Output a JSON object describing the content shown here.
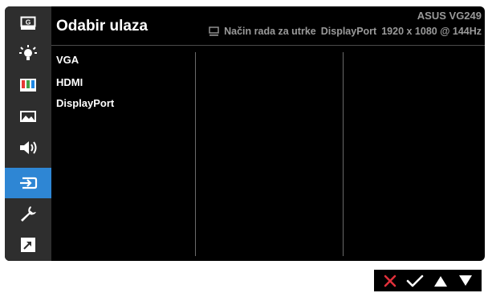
{
  "header": {
    "title": "Odabir ulaza",
    "model": "ASUS  VG249",
    "mode": "Način rada za utrke",
    "input": "DisplayPort",
    "resolution": "1920 x 1080 @ 144Hz"
  },
  "sidebar": {
    "items": [
      {
        "name": "gameplus",
        "label": "G",
        "active": false
      },
      {
        "name": "splendid",
        "active": false
      },
      {
        "name": "color",
        "active": false
      },
      {
        "name": "image",
        "active": false
      },
      {
        "name": "sound",
        "active": false
      },
      {
        "name": "input-select",
        "active": true
      },
      {
        "name": "system-setup",
        "active": false
      },
      {
        "name": "shortcut",
        "active": false
      }
    ]
  },
  "options": [
    "VGA",
    "HDMI",
    "DisplayPort"
  ],
  "nav": {
    "close_icon": "close-icon",
    "confirm_icon": "check-icon",
    "up_icon": "arrow-up-icon",
    "down_icon": "arrow-down-icon"
  },
  "colors": {
    "accent": "#2e86d4",
    "sidebar_bg": "#2e2e2e",
    "close": "#e0303a",
    "status_text": "#9a9a9a"
  }
}
